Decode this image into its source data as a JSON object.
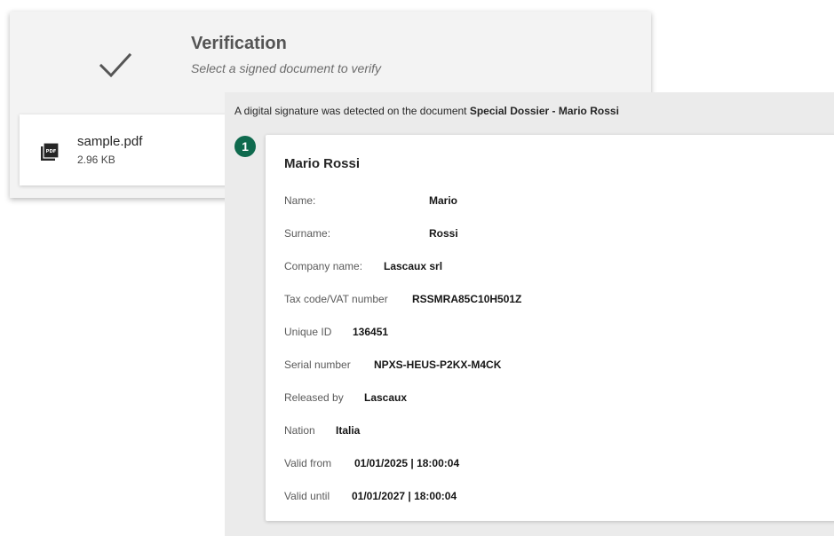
{
  "verification": {
    "title": "Verification",
    "subtitle": "Select a signed document to verify",
    "check_icon": "checkmark-icon"
  },
  "file": {
    "name": "sample.pdf",
    "size": "2.96 KB",
    "icon": "pdf-file-icon"
  },
  "result": {
    "detected_prefix": "A digital signature was detected on the document ",
    "document_name": "Special Dossier - Mario Rossi",
    "badge_number": "1"
  },
  "signature": {
    "signer": "Mario Rossi",
    "fields": [
      {
        "label": "Name:",
        "value": "Mario"
      },
      {
        "label": "Surname:",
        "value": "Rossi"
      },
      {
        "label": "Company name:",
        "value": "Lascaux srl"
      },
      {
        "label": "Tax code/VAT number",
        "value": "RSSMRA85C10H501Z"
      },
      {
        "label": "Unique ID",
        "value": "136451"
      },
      {
        "label": "Serial number",
        "value": "NPXS-HEUS-P2KX-M4CK"
      },
      {
        "label": "Released by",
        "value": "Lascaux"
      },
      {
        "label": "Nation",
        "value": "Italia"
      },
      {
        "label": "Valid from",
        "value": "01/01/2025 | 18:00:04"
      },
      {
        "label": "Valid until",
        "value": "01/01/2027 | 18:00:04"
      }
    ]
  },
  "colors": {
    "badge": "#0f6a4e",
    "header_background": "#f3f3f3",
    "panel_background": "#ebebeb"
  }
}
